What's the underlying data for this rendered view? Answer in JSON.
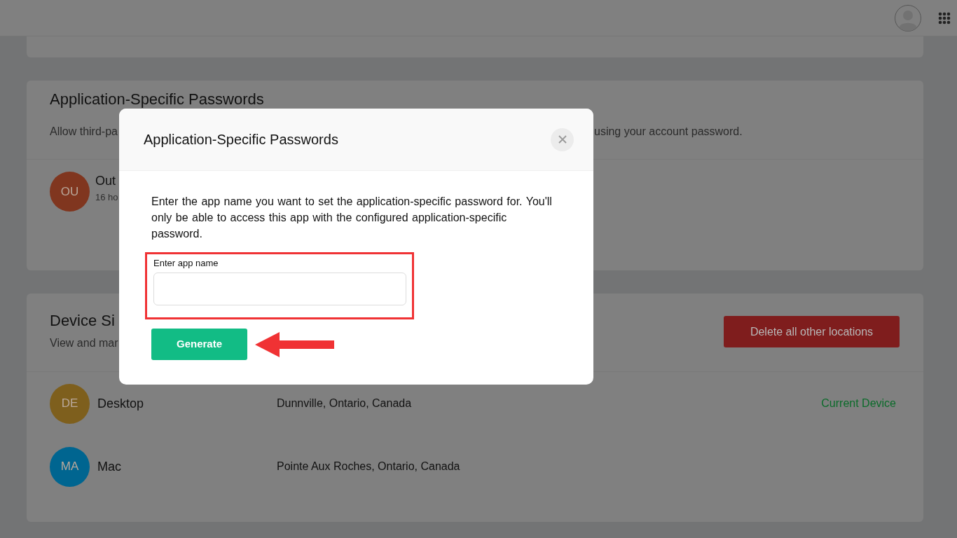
{
  "sections": [
    {
      "kind": "empty"
    },
    {
      "kind": "passwords",
      "title": "Application-Specific Passwords",
      "subtitle_left": "Allow third-pa",
      "subtitle_right": "using your account password.",
      "rows": [
        {
          "initials": "OU",
          "color": "#80361f",
          "name": "Out",
          "meta": "16 ho"
        }
      ]
    },
    {
      "kind": "devices",
      "title": "Device Si",
      "subtitle_left": "View and mar",
      "action": "Delete all other locations",
      "rows": [
        {
          "initials": "DE",
          "color": "#7e5f1d",
          "name": "Desktop",
          "location": "Dunnville, Ontario, Canada",
          "status": "Current Device"
        },
        {
          "initials": "MA",
          "color": "#006590",
          "name": "Mac",
          "location": "Pointe Aux Roches, Ontario, Canada"
        }
      ]
    }
  ],
  "modal": {
    "title": "Application-Specific Passwords",
    "text": "Enter the app name you want to set the application-specific password for. You'll only be able to access this app with the configured application-specific password.",
    "field_label": "Enter app name",
    "field_highlighted": true,
    "button": "Generate",
    "arrow": true
  }
}
